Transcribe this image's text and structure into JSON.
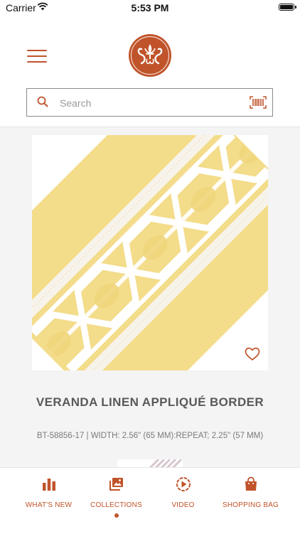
{
  "status_bar": {
    "carrier": "Carrier",
    "time": "5:53 PM"
  },
  "brand": {
    "accent_color": "#c0532a"
  },
  "search": {
    "placeholder": "Search"
  },
  "product": {
    "title": "VERANDA LINEN APPLIQUÉ  BORDER",
    "specs": "BT-58856-17 | WIDTH: 2.56\" (65 MM):REPEAT; 2.25\" (57 MM)",
    "favorite_icon": "heart-outline-icon"
  },
  "tabs": [
    {
      "label": "WHAT'S NEW",
      "icon": "bar-chart-icon"
    },
    {
      "label": "COLLECTIONS",
      "icon": "image-gallery-icon",
      "active": true
    },
    {
      "label": "VIDEO",
      "icon": "play-circle-icon"
    },
    {
      "label": "SHOPPING BAG",
      "icon": "shopping-bag-icon"
    }
  ]
}
